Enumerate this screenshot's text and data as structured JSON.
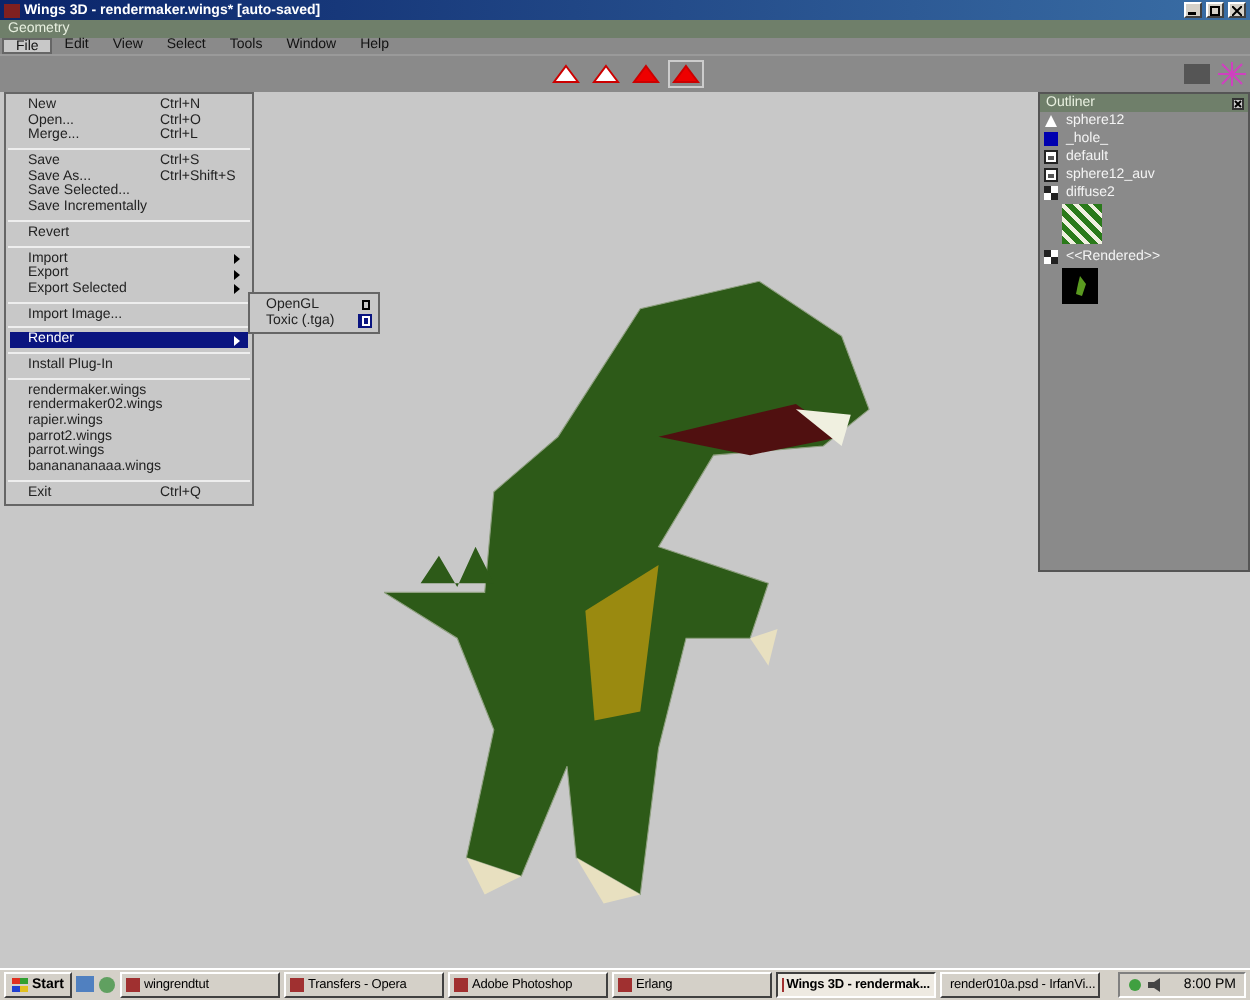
{
  "window": {
    "title": "Wings 3D - rendermaker.wings* [auto-saved]"
  },
  "geometry_bar": {
    "title": "Geometry"
  },
  "menubar": [
    {
      "label": "File",
      "selected": true
    },
    {
      "label": "Edit",
      "selected": false
    },
    {
      "label": "View",
      "selected": false
    },
    {
      "label": "Select",
      "selected": false
    },
    {
      "label": "Tools",
      "selected": false
    },
    {
      "label": "Window",
      "selected": false
    },
    {
      "label": "Help",
      "selected": false
    }
  ],
  "selection_modes": [
    {
      "kind": "vertex",
      "selected": false
    },
    {
      "kind": "edge",
      "selected": false
    },
    {
      "kind": "face",
      "selected": false
    },
    {
      "kind": "body",
      "selected": true
    }
  ],
  "file_menu": [
    {
      "kind": "item",
      "label": "New",
      "shortcut": "Ctrl+N",
      "submenu": false,
      "selected": false
    },
    {
      "kind": "item",
      "label": "Open...",
      "shortcut": "Ctrl+O",
      "submenu": false,
      "selected": false
    },
    {
      "kind": "item",
      "label": "Merge...",
      "shortcut": "Ctrl+L",
      "submenu": false,
      "selected": false
    },
    {
      "kind": "separator"
    },
    {
      "kind": "item",
      "label": "Save",
      "shortcut": "Ctrl+S",
      "submenu": false,
      "selected": false
    },
    {
      "kind": "item",
      "label": "Save As...",
      "shortcut": "Ctrl+Shift+S",
      "submenu": false,
      "selected": false
    },
    {
      "kind": "item",
      "label": "Save Selected...",
      "submenu": false,
      "selected": false
    },
    {
      "kind": "item",
      "label": "Save Incrementally",
      "submenu": false,
      "selected": false
    },
    {
      "kind": "separator"
    },
    {
      "kind": "item",
      "label": "Revert",
      "submenu": false,
      "selected": false
    },
    {
      "kind": "separator"
    },
    {
      "kind": "item",
      "label": "Import",
      "submenu": true,
      "selected": false
    },
    {
      "kind": "item",
      "label": "Export",
      "submenu": true,
      "selected": false
    },
    {
      "kind": "item",
      "label": "Export Selected",
      "submenu": true,
      "selected": false
    },
    {
      "kind": "separator"
    },
    {
      "kind": "item",
      "label": "Import Image...",
      "submenu": false,
      "selected": false
    },
    {
      "kind": "separator"
    },
    {
      "kind": "item",
      "label": "Render",
      "submenu": true,
      "selected": true
    },
    {
      "kind": "separator"
    },
    {
      "kind": "item",
      "label": "Install Plug-In",
      "submenu": false,
      "selected": false
    },
    {
      "kind": "separator"
    },
    {
      "kind": "item",
      "label": "rendermaker.wings",
      "submenu": false,
      "selected": false
    },
    {
      "kind": "item",
      "label": "rendermaker02.wings",
      "submenu": false,
      "selected": false
    },
    {
      "kind": "item",
      "label": "rapier.wings",
      "submenu": false,
      "selected": false
    },
    {
      "kind": "item",
      "label": "parrot2.wings",
      "submenu": false,
      "selected": false
    },
    {
      "kind": "item",
      "label": "parrot.wings",
      "submenu": false,
      "selected": false
    },
    {
      "kind": "item",
      "label": "bananananaaa.wings",
      "submenu": false,
      "selected": false
    },
    {
      "kind": "separator"
    },
    {
      "kind": "item",
      "label": "Exit",
      "shortcut": "Ctrl+Q",
      "submenu": false,
      "selected": false
    }
  ],
  "render_submenu": [
    {
      "label": "OpenGL",
      "option_selected": false
    },
    {
      "label": "Toxic (.tga)",
      "option_selected": true
    }
  ],
  "outliner": {
    "title": "Outliner",
    "items": [
      {
        "kind": "object",
        "label": "sphere12"
      },
      {
        "kind": "hole",
        "label": "_hole_"
      },
      {
        "kind": "material",
        "label": "default"
      },
      {
        "kind": "material",
        "label": "sphere12_auv"
      },
      {
        "kind": "image",
        "label": "diffuse2"
      },
      {
        "kind": "render",
        "label": "<<Rendered>>"
      }
    ]
  },
  "taskbar": {
    "start": "Start",
    "tasks": [
      {
        "label": "wingrendtut",
        "active": false
      },
      {
        "label": "Transfers - Opera",
        "active": false
      },
      {
        "label": "Adobe Photoshop",
        "active": false
      },
      {
        "label": "Erlang",
        "active": false
      },
      {
        "label": "Wings 3D - rendermak...",
        "active": true
      },
      {
        "label": "render010a.psd - IrfanVi...",
        "active": false
      }
    ],
    "clock": "8:00 PM"
  }
}
